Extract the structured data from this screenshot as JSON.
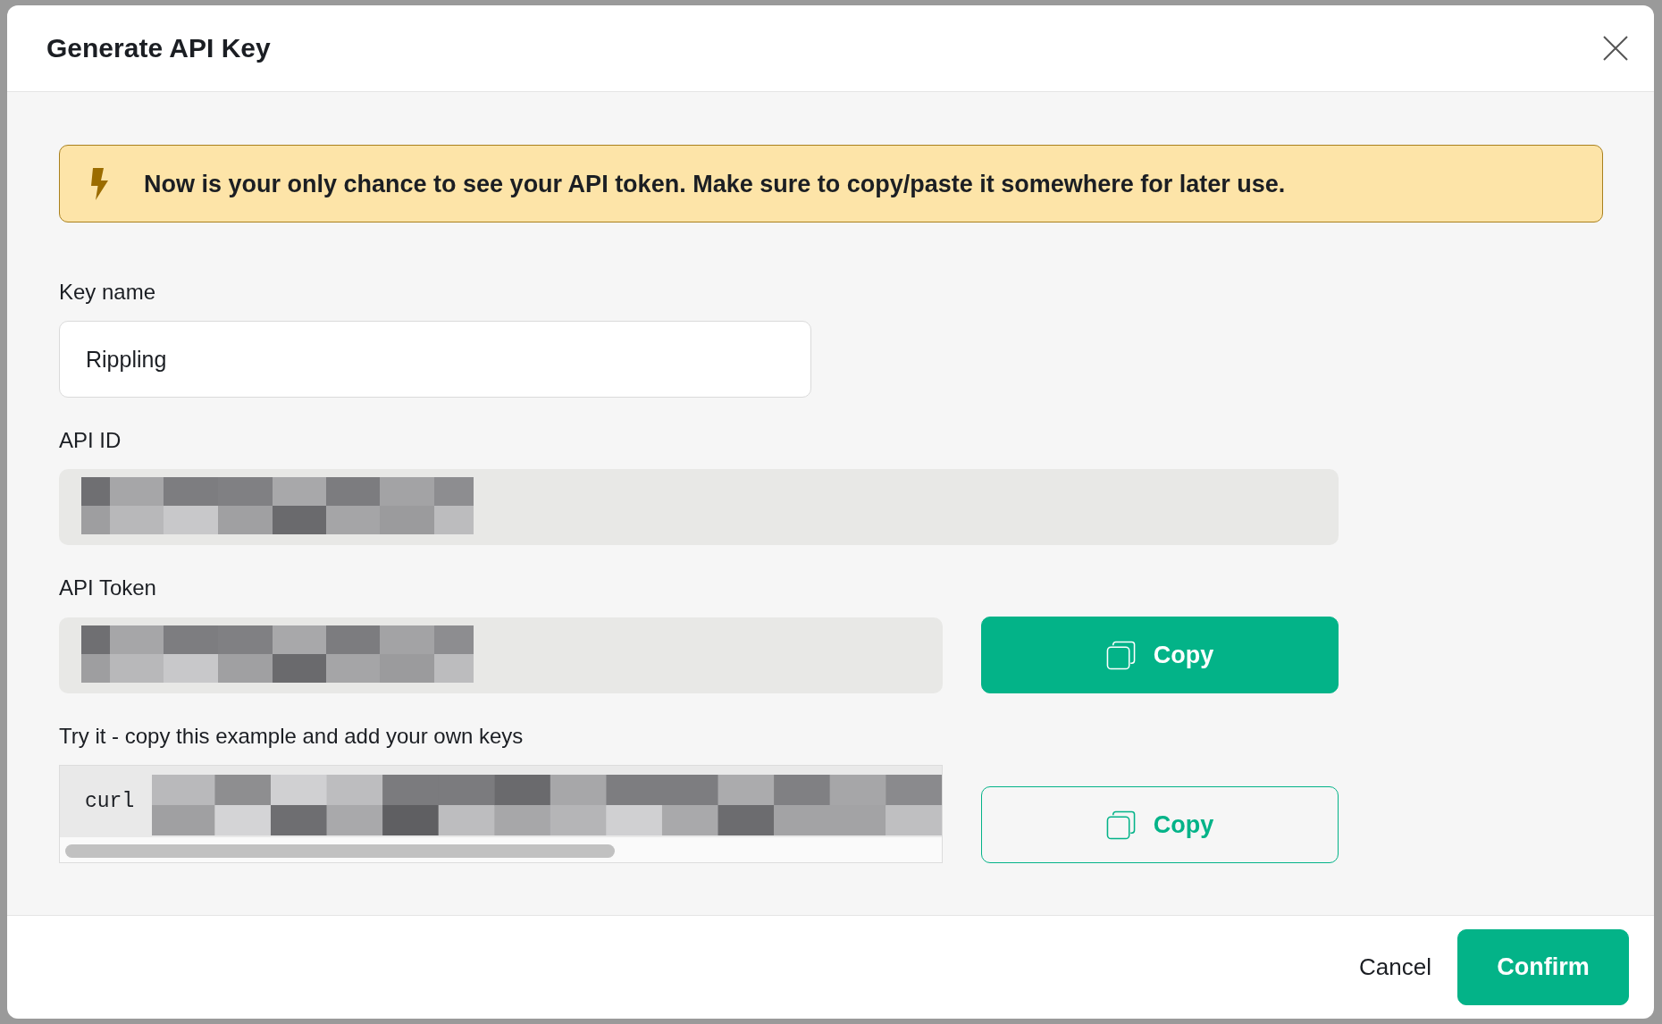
{
  "dialog": {
    "title": "Generate API Key",
    "notice": "Now is your only chance to see your API token. Make sure to copy/paste it somewhere for later use.",
    "fields": [
      {
        "kind": "input",
        "label": "Key name",
        "value": "Rippling"
      },
      {
        "kind": "redacted",
        "label": "API ID"
      },
      {
        "kind": "redacted",
        "label": "API Token",
        "action": {
          "label": "Copy",
          "kind": "primary"
        }
      },
      {
        "kind": "code",
        "label": "Try it - copy this example and add your own keys",
        "command": "curl",
        "action": {
          "label": "Copy",
          "kind": "outline"
        }
      }
    ],
    "buttons": [
      {
        "label": "Cancel",
        "kind": "text"
      },
      {
        "label": "Confirm",
        "kind": "primary"
      }
    ]
  }
}
